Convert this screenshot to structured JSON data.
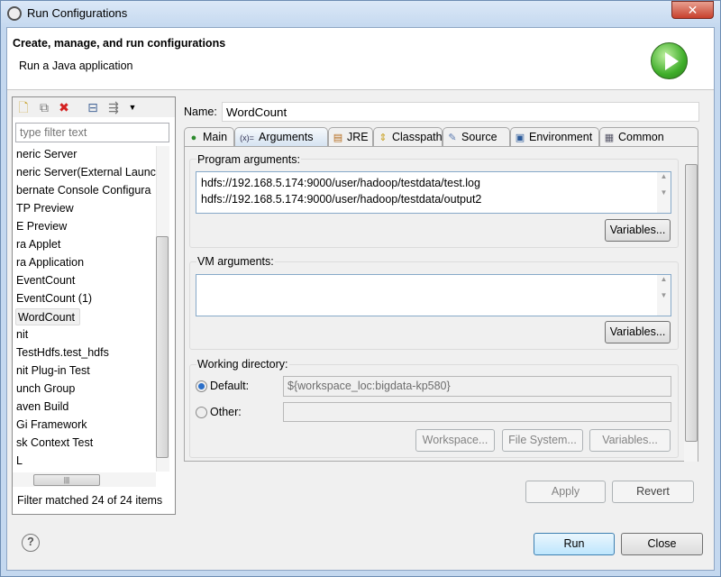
{
  "window": {
    "title": "Run Configurations",
    "close_label": "✕"
  },
  "header": {
    "title": "Create, manage, and run configurations",
    "subtitle": "Run a Java application"
  },
  "left": {
    "filter_placeholder": "type filter text",
    "items": [
      "neric Server",
      "neric Server(External Launc",
      "bernate Console Configura",
      "TP Preview",
      "E Preview",
      "ra Applet",
      "ra Application",
      "EventCount",
      "EventCount (1)",
      "WordCount",
      "nit",
      "TestHdfs.test_hdfs",
      "nit Plug-in Test",
      "unch Group",
      "aven Build",
      "Gi Framework",
      "sk Context Test",
      "L"
    ],
    "selected": "WordCount",
    "footer": "Filter matched 24 of 24 items"
  },
  "name": {
    "label": "Name:",
    "value": "WordCount"
  },
  "tabs": [
    {
      "label": "Main",
      "icon": "main-icon"
    },
    {
      "label": "Arguments",
      "icon": "arguments-icon"
    },
    {
      "label": "JRE",
      "icon": "jre-icon"
    },
    {
      "label": "Classpath",
      "icon": "classpath-icon"
    },
    {
      "label": "Source",
      "icon": "source-icon"
    },
    {
      "label": "Environment",
      "icon": "environment-icon"
    },
    {
      "label": "Common",
      "icon": "common-icon"
    }
  ],
  "active_tab": "Arguments",
  "program_args": {
    "label": "Program arguments:",
    "value": "hdfs://192.168.5.174:9000/user/hadoop/testdata/test.log\nhdfs://192.168.5.174:9000/user/hadoop/testdata/output2",
    "variables": "Variables..."
  },
  "vm_args": {
    "label": "VM arguments:",
    "value": "",
    "variables": "Variables..."
  },
  "working_dir": {
    "label": "Working directory:",
    "default_label": "Default:",
    "default_value": "${workspace_loc:bigdata-kp580}",
    "other_label": "Other:",
    "other_value": "",
    "workspace": "Workspace...",
    "file_system": "File System...",
    "variables": "Variables...",
    "selected": "Default"
  },
  "buttons": {
    "apply": "Apply",
    "revert": "Revert",
    "run": "Run",
    "close": "Close",
    "help": "?"
  }
}
